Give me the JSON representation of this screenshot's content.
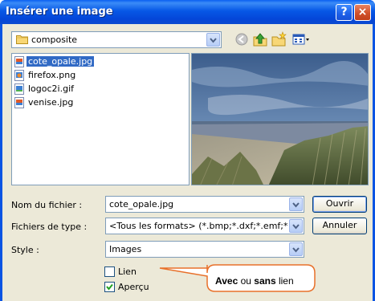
{
  "window": {
    "title": "Insérer une image",
    "help_glyph": "?",
    "close_glyph": "×"
  },
  "lookin": {
    "value": "composite",
    "icons": [
      "folder-icon",
      "back-icon",
      "up-folder-icon",
      "new-folder-icon",
      "views-menu-icon"
    ]
  },
  "files": [
    {
      "name": "cote_opale.jpg",
      "icon": "jpg-icon",
      "selected": true
    },
    {
      "name": "firefox.png",
      "icon": "png-icon",
      "selected": false
    },
    {
      "name": "logoc2i.gif",
      "icon": "gif-icon",
      "selected": false
    },
    {
      "name": "venise.jpg",
      "icon": "jpg-icon",
      "selected": false
    }
  ],
  "form": {
    "filename_label": "Nom du fichier :",
    "filename_value": "cote_opale.jpg",
    "filetype_label": "Fichiers de type :",
    "filetype_value": "<Tous les formats> (*.bmp;*.dxf;*.emf;*.eps;*.gif;",
    "style_label": "Style :",
    "style_value": "Images",
    "link_label": "Lien",
    "link_checked": false,
    "preview_label": "Aperçu",
    "preview_checked": true
  },
  "buttons": {
    "open": "Ouvrir",
    "cancel": "Annuler"
  },
  "callout": {
    "part1": "Avec",
    "part2": " ou ",
    "part3": "sans",
    "part4": " lien"
  },
  "colors": {
    "title_bar": "#0a54e3",
    "selection": "#316ac5",
    "dialog_bg": "#ece9d8",
    "callout_border": "#e8702a"
  }
}
